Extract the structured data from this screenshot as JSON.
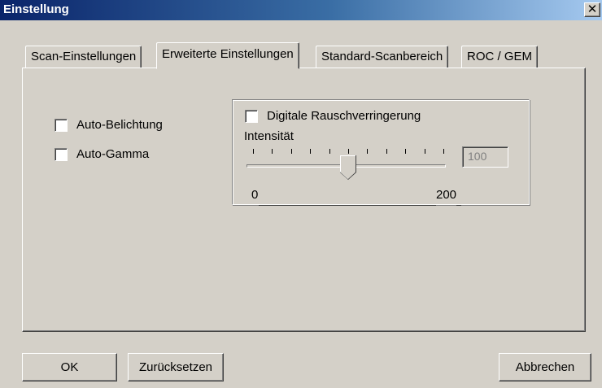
{
  "window": {
    "title": "Einstellung",
    "close_glyph": "✕"
  },
  "tabs": [
    {
      "label": "Scan-Einstellungen",
      "active": false
    },
    {
      "label": "Erweiterte Einstellungen",
      "active": true
    },
    {
      "label": "Standard-Scanbereich",
      "active": false
    },
    {
      "label": "ROC / GEM",
      "active": false
    }
  ],
  "options": {
    "auto_exposure": {
      "label": "Auto-Belichtung",
      "checked": false
    },
    "auto_gamma": {
      "label": "Auto-Gamma",
      "checked": false
    }
  },
  "noise_reduction": {
    "label": "Digitale Rauschverringerung",
    "checked": false,
    "intensity_label": "Intensität",
    "value": "100",
    "min_label": "0",
    "max_label": "200",
    "min": 0,
    "max": 200,
    "slider_value": 100
  },
  "buttons": {
    "ok": "OK",
    "reset": "Zurücksetzen",
    "cancel": "Abbrechen"
  }
}
